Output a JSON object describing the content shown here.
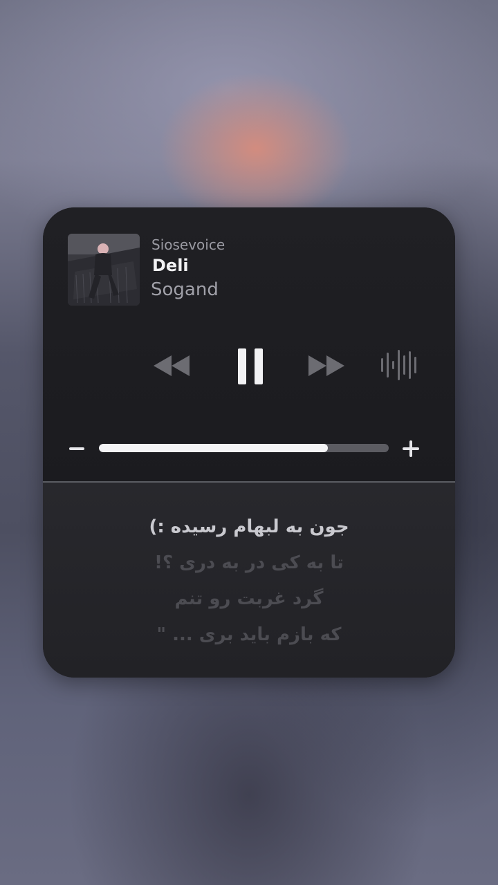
{
  "now_playing": {
    "artist": "Siosevoice",
    "title": "Deli",
    "subtitle": "Sogand"
  },
  "controls": {
    "rewind_icon": "rewind-icon",
    "pause_icon": "pause-icon",
    "forward_icon": "fast-forward-icon",
    "waveform_icon": "waveform-icon"
  },
  "volume": {
    "level": 0.79
  },
  "lyrics": [
    "جون به لبهام رسیده :)",
    "تا به کی در به دری ؟!",
    "گرد غربت رو تنم",
    "که بازم باید بری ... \""
  ],
  "colors": {
    "widget_bg": "#1c1c20",
    "lyrics_bg": "#26262a",
    "active_lyric": "#c9c9cf",
    "dim_lyric": "#4c4c52",
    "volume_fill": "#f4f4f6",
    "volume_track": "#5c5c62"
  }
}
